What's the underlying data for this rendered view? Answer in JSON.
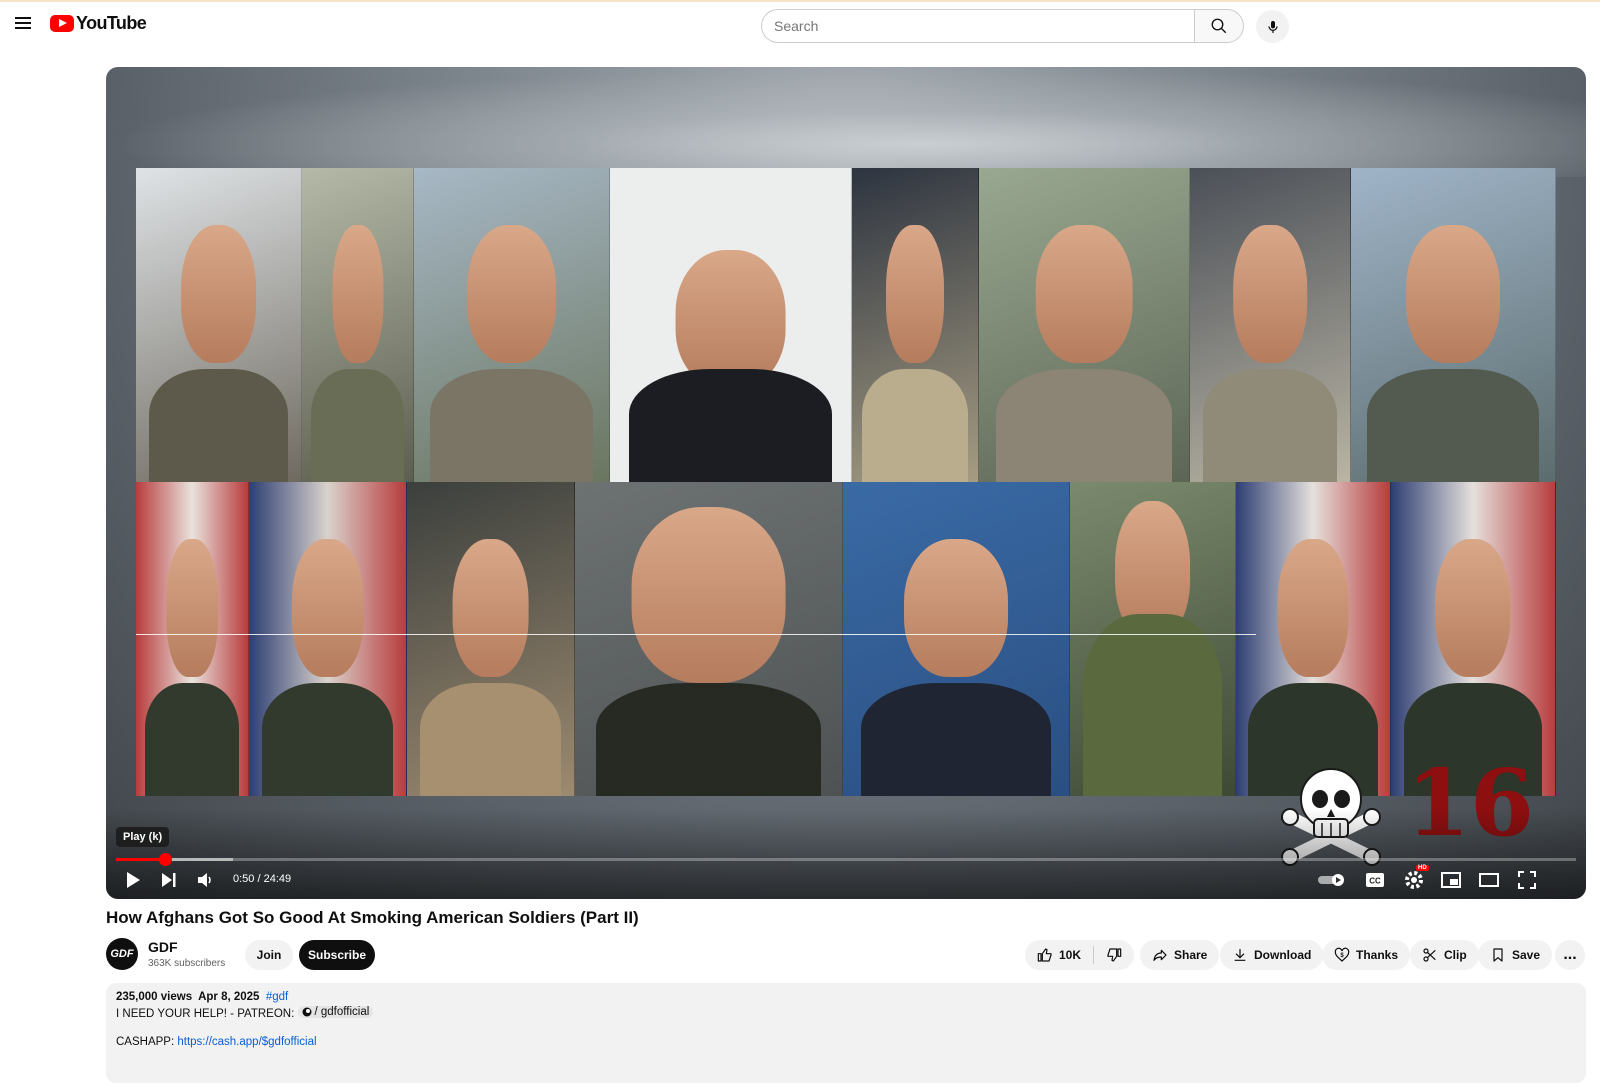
{
  "header": {
    "logo_text": "YouTube",
    "search_placeholder": "Search",
    "menu_icon": "hamburger-icon",
    "search_icon": "search-icon",
    "mic_icon": "mic-icon"
  },
  "player": {
    "overlay_number": "16",
    "tooltip": "Play (k)",
    "current_time": "0:50",
    "duration": "24:49",
    "progress_played_fraction": 0.0336,
    "progress_buffered_fraction": 0.08,
    "icons": [
      "play-icon",
      "next-icon",
      "volume-icon",
      "autoplay-toggle-icon",
      "captions-icon",
      "settings-icon",
      "miniplayer-icon",
      "theater-icon",
      "fullscreen-icon"
    ],
    "hd_badge": "HD"
  },
  "video": {
    "title": "How Afghans Got So Good At Smoking American Soldiers (Part II)"
  },
  "channel": {
    "avatar_text": "GDF",
    "name": "GDF",
    "subscribers": "363K subscribers",
    "join_label": "Join",
    "subscribe_label": "Subscribe"
  },
  "actions": {
    "likes": "10K",
    "share": "Share",
    "download": "Download",
    "thanks": "Thanks",
    "clip": "Clip",
    "save": "Save",
    "more": "..."
  },
  "description": {
    "views": "235,000 views",
    "date": "Apr 8, 2025",
    "hashtag": "#gdf",
    "help_text": "I NEED YOUR HELP!  -  PATREON:",
    "patreon_handle": "/ gdfofficial",
    "cashapp_label": "CASHAPP:",
    "cashapp_link": "https://cash.app/$gdfofficial"
  },
  "colors": {
    "brand_red": "#ff0000",
    "link_blue": "#065fd4",
    "overlay_red": "#8d0f10"
  }
}
